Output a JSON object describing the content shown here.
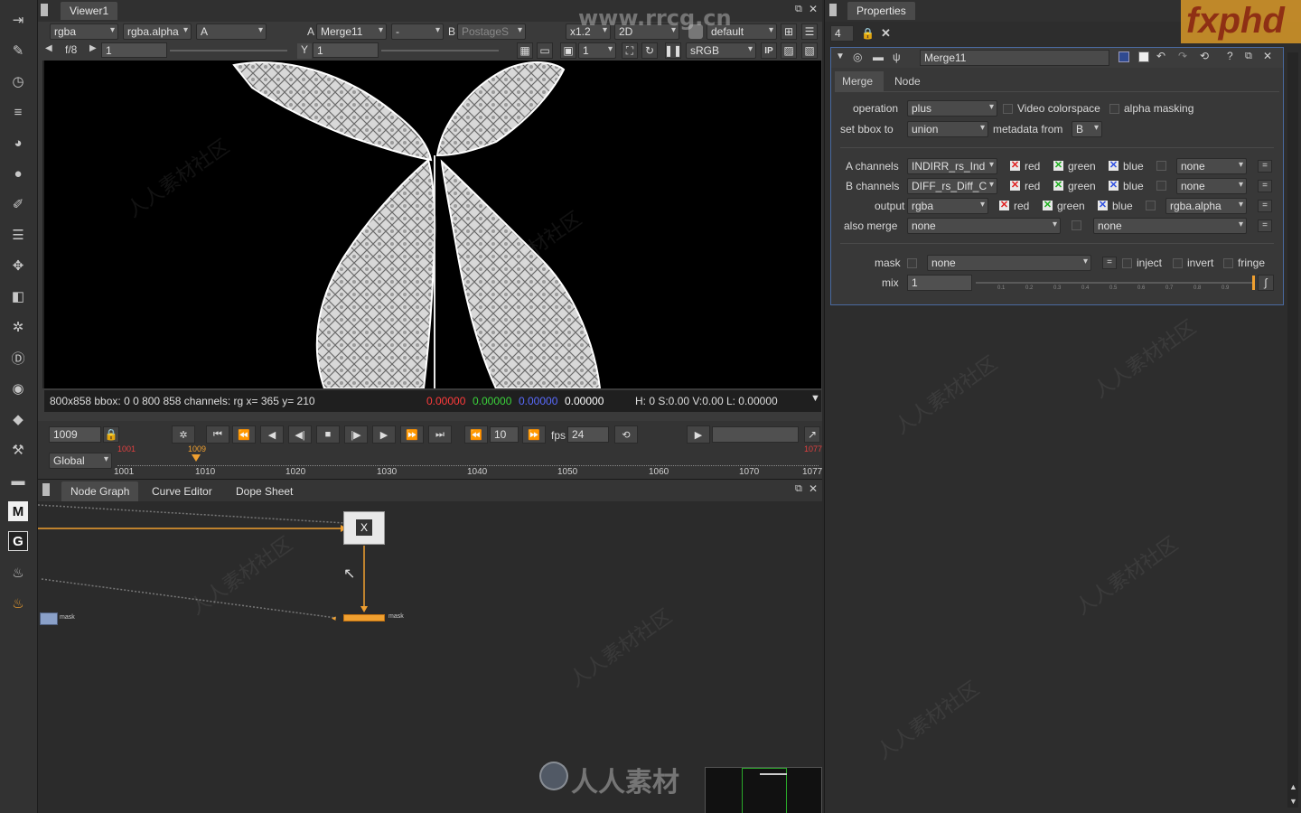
{
  "watermark_top": "www.rrcg.cn",
  "logo": "fxphd",
  "watermark_cjk": "人人素材社区",
  "bottom_logo": "人人素材",
  "viewer": {
    "tab": "Viewer1",
    "channels": "rgba",
    "alpha": "rgba.alpha",
    "a_input": "A",
    "a_label": "A",
    "merge_node": "Merge11",
    "dash": "-",
    "b_label": "B",
    "b_input": "PostageS",
    "zoom": "x1.2",
    "view_mode": "2D",
    "lut": "default",
    "fstop": "f/8",
    "gain_value": "1",
    "y_label": "Y",
    "gamma_value": "1",
    "proxy": "1",
    "colorspace": "sRGB",
    "ip_label": "IP",
    "info": {
      "format": "800x858 bbox: 0 0 800 858 channels: rg  x= 365 y= 210",
      "r": "0.00000",
      "g": "0.00000",
      "b": "0.00000",
      "a": "0.00000",
      "hsv": "H:  0 S:0.00 V:0.00  L: 0.00000"
    }
  },
  "timeline": {
    "current_frame": "1009",
    "skip": "10",
    "fps_label": "fps",
    "fps": "24",
    "range_mode": "Global",
    "start": "1001",
    "end": "1077",
    "marker": "1009",
    "ticks": [
      "1001",
      "1010",
      "1020",
      "1030",
      "1040",
      "1050",
      "1060",
      "1070",
      "1077"
    ]
  },
  "nodegraph": {
    "tabs": [
      "Node Graph",
      "Curve Editor",
      "Dope Sheet"
    ],
    "merge_label": "X",
    "mask_label": "mask"
  },
  "properties": {
    "title": "Properties",
    "max_panels": "4",
    "node_name": "Merge11",
    "tabs": [
      "Merge",
      "Node"
    ],
    "operation_label": "operation",
    "operation": "plus",
    "video_colorspace": "Video colorspace",
    "alpha_masking": "alpha masking",
    "bbox_label": "set bbox to",
    "bbox": "union",
    "metadata_label": "metadata from",
    "metadata": "B",
    "a_channels_label": "A channels",
    "a_channels": "INDIRR_rs_Ind",
    "b_channels_label": "B channels",
    "b_channels": "DIFF_rs_Diff_C",
    "output_label": "output",
    "output": "rgba",
    "also_merge_label": "also merge",
    "also_merge": "none",
    "also_merge2": "none",
    "red": "red",
    "green": "green",
    "blue": "blue",
    "none": "none",
    "rgba_alpha": "rgba.alpha",
    "mask_label": "mask",
    "mask": "none",
    "inject": "inject",
    "invert": "invert",
    "fringe": "fringe",
    "mix_label": "mix",
    "mix": "1",
    "slider_ticks": [
      "0.1",
      "0.2",
      "0.3",
      "0.4",
      "0.5",
      "0.6",
      "0.7",
      "0.8",
      "0.9"
    ]
  }
}
